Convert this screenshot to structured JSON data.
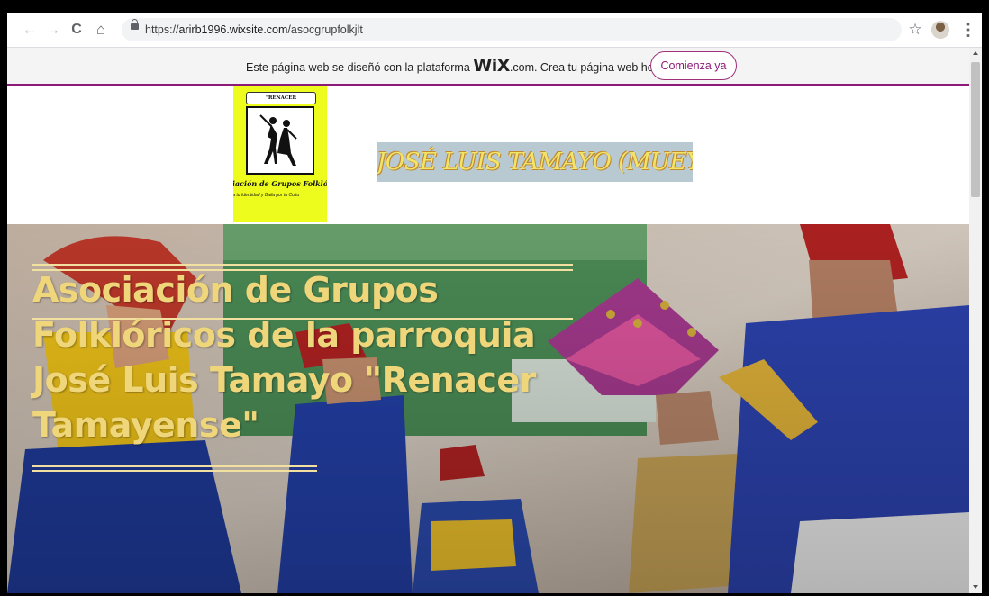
{
  "browser": {
    "url_prefix": "https://",
    "url_host": "arirb1996.wixsite.com",
    "url_path": "/asocgrupfolkjlt",
    "back_icon": "←",
    "forward_icon": "→",
    "reload_icon": "C",
    "home_icon": "⌂",
    "star_icon": "☆",
    "menu_icon": "⋮"
  },
  "wix_banner": {
    "text_before": "Este página web se diseñó con la plataforma",
    "logo": "WiX",
    "text_after": ".com. Crea tu página web hoy.",
    "cta_label": "Comienza ya"
  },
  "site": {
    "logo_banner": "\"RENACER TAMAYENSE\"",
    "logo_caption": "ciación de Grupos Folklór",
    "logo_tagline": "nza tu Identidad y Baila por tu Cultu",
    "title": "JOSÉ LUIS TAMAYO (MUEY)"
  },
  "hero": {
    "title": "Asociación de Grupos Folklóricos de la parroquia José Luis Tamayo \"Renacer Tamayense\""
  },
  "colors": {
    "wix_accent": "#8e1a78",
    "hero_text": "#f0d67a",
    "logo_bg": "#eefc1d"
  }
}
